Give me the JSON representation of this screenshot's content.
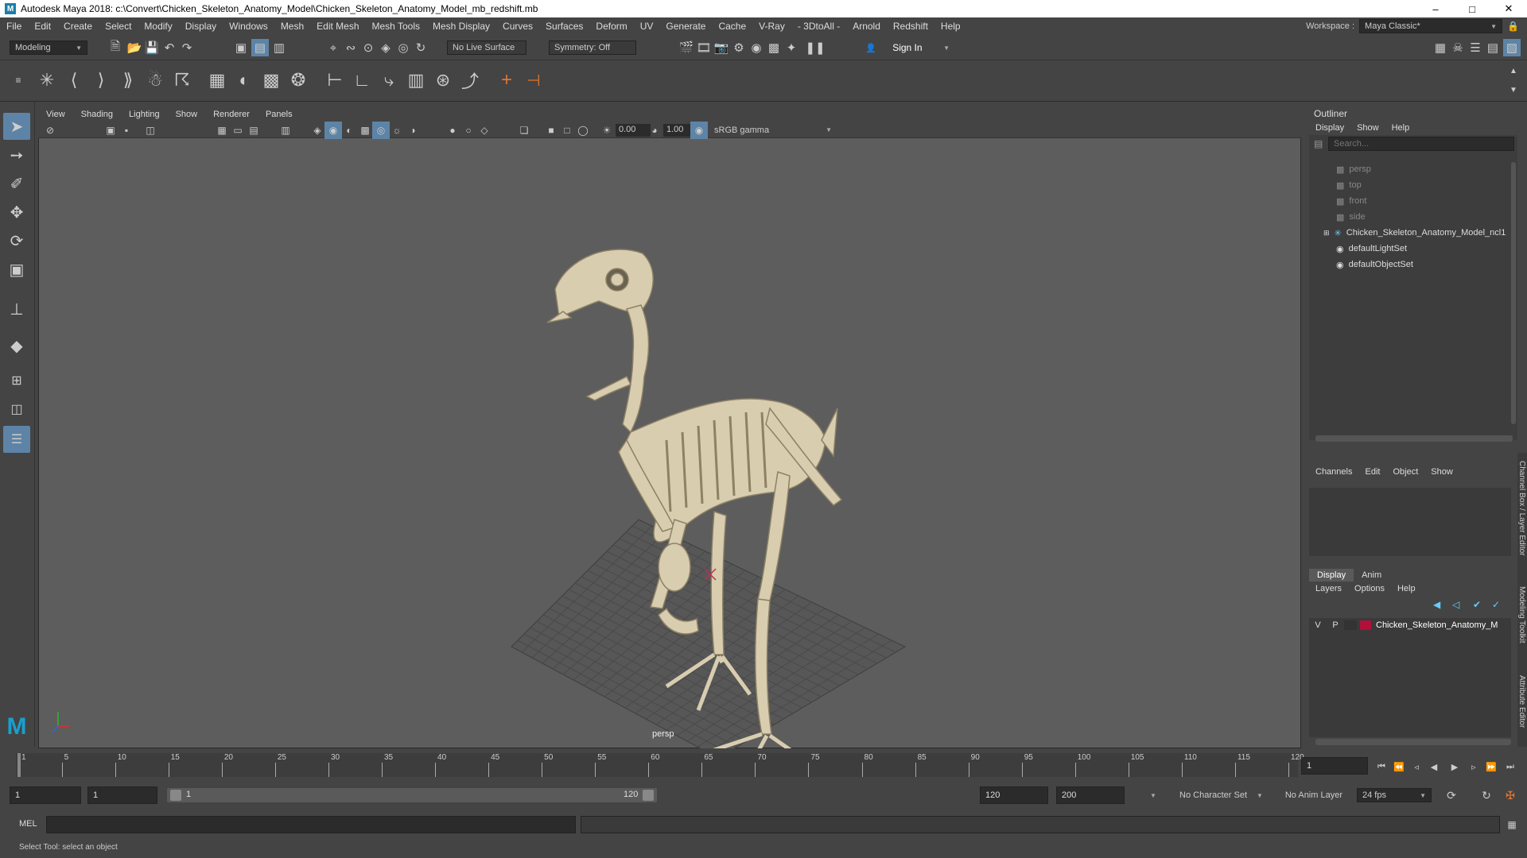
{
  "title": "Autodesk Maya 2018: c:\\Convert\\Chicken_Skeleton_Anatomy_Model\\Chicken_Skeleton_Anatomy_Model_mb_redshift.mb",
  "menus": [
    "File",
    "Edit",
    "Create",
    "Select",
    "Modify",
    "Display",
    "Windows",
    "Mesh",
    "Edit Mesh",
    "Mesh Tools",
    "Mesh Display",
    "Curves",
    "Surfaces",
    "Deform",
    "UV",
    "Generate",
    "Cache",
    "V-Ray",
    "- 3DtoAll -",
    "Arnold",
    "Redshift",
    "Help"
  ],
  "workspace": {
    "label": "Workspace :",
    "value": "Maya Classic*"
  },
  "status": {
    "mode": "Modeling",
    "live_surface": "No Live Surface",
    "symmetry": "Symmetry: Off",
    "sign_in": "Sign In"
  },
  "viewport": {
    "menus": [
      "View",
      "Shading",
      "Lighting",
      "Show",
      "Renderer",
      "Panels"
    ],
    "exposure": "0.00",
    "gamma": "1.00",
    "colorspace": "sRGB gamma",
    "camera_label": "persp"
  },
  "outliner": {
    "title": "Outliner",
    "menus": [
      "Display",
      "Show",
      "Help"
    ],
    "search_placeholder": "Search...",
    "items": [
      {
        "label": "persp",
        "dim": true
      },
      {
        "label": "top",
        "dim": true
      },
      {
        "label": "front",
        "dim": true
      },
      {
        "label": "side",
        "dim": true
      },
      {
        "label": "Chicken_Skeleton_Anatomy_Model_ncl1",
        "dim": false
      },
      {
        "label": "defaultLightSet",
        "dim": false
      },
      {
        "label": "defaultObjectSet",
        "dim": false
      }
    ]
  },
  "channelbox": {
    "menus": [
      "Channels",
      "Edit",
      "Object",
      "Show"
    ]
  },
  "layers": {
    "tabs": [
      "Display",
      "Anim"
    ],
    "menus": [
      "Layers",
      "Options",
      "Help"
    ],
    "row": {
      "v": "V",
      "p": "P",
      "name": "Chicken_Skeleton_Anatomy_M",
      "color": "#b0103a"
    }
  },
  "side_tabs": [
    "Channel Box / Layer Editor",
    "Modeling Toolkit",
    "Attribute Editor"
  ],
  "timeline": {
    "ticks": [
      "1",
      "5",
      "10",
      "15",
      "20",
      "25",
      "30",
      "35",
      "40",
      "45",
      "50",
      "55",
      "60",
      "65",
      "70",
      "75",
      "80",
      "85",
      "90",
      "95",
      "100",
      "105",
      "110",
      "115",
      "120"
    ],
    "current_frame": "1"
  },
  "range": {
    "start": "1",
    "playback_start": "1",
    "slider_start": "1",
    "slider_end": "120",
    "playback_end": "120",
    "end": "200",
    "character_set": "No Character Set",
    "anim_layer": "No Anim Layer",
    "fps": "24 fps"
  },
  "cmd": {
    "label": "MEL"
  },
  "help_line": "Select Tool: select an object",
  "colors": {
    "ui_bg": "#444444",
    "viewport_bg": "#5d5d5d",
    "active_tool": "#5d84a6",
    "bone": "#d9cdb0"
  }
}
